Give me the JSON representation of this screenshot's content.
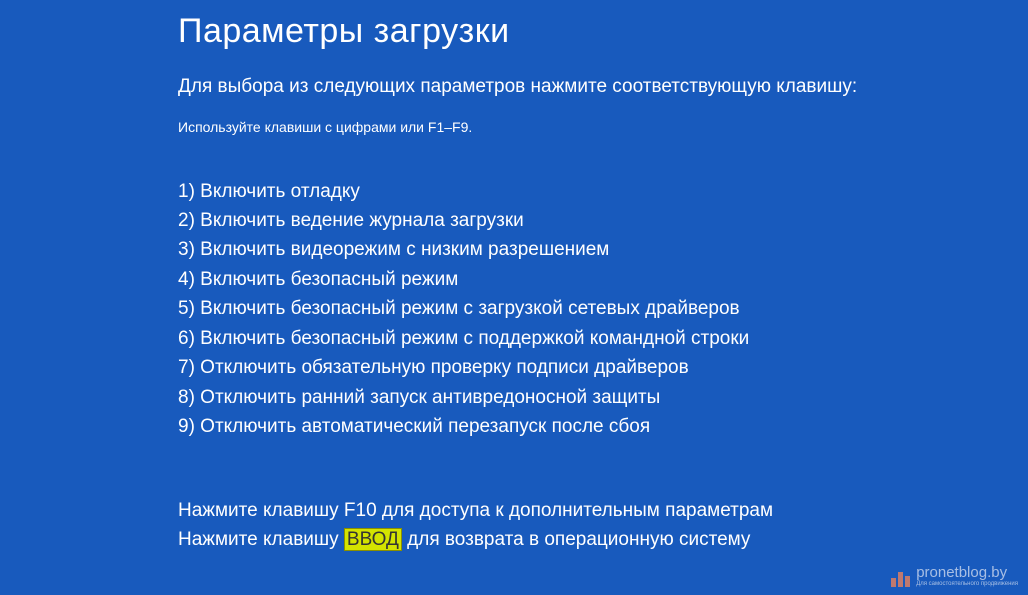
{
  "title": "Параметры загрузки",
  "subtitle": "Для выбора из следующих параметров нажмите соответствующую клавишу:",
  "hint": "Используйте клавиши с цифрами или F1–F9.",
  "options": [
    "1) Включить отладку",
    "2) Включить ведение журнала загрузки",
    "3) Включить видеорежим с низким разрешением",
    "4) Включить безопасный режим",
    "5) Включить безопасный режим с загрузкой сетевых драйверов",
    "6) Включить безопасный режим с поддержкой командной строки",
    "7) Отключить обязательную проверку подписи драйверов",
    "8) Отключить ранний запуск антивредоносной защиты",
    "9) Отключить автоматический перезапуск после сбоя"
  ],
  "footer": {
    "line1": "Нажмите клавишу F10 для доступа к дополнительным параметрам",
    "line2_before": "Нажмите клавишу ",
    "line2_highlight": "ВВОД",
    "line2_after": " для возврата в операционную систему"
  },
  "watermark": {
    "text": "pronetblog.by",
    "sub": "Для самостоятельного продвижения"
  }
}
